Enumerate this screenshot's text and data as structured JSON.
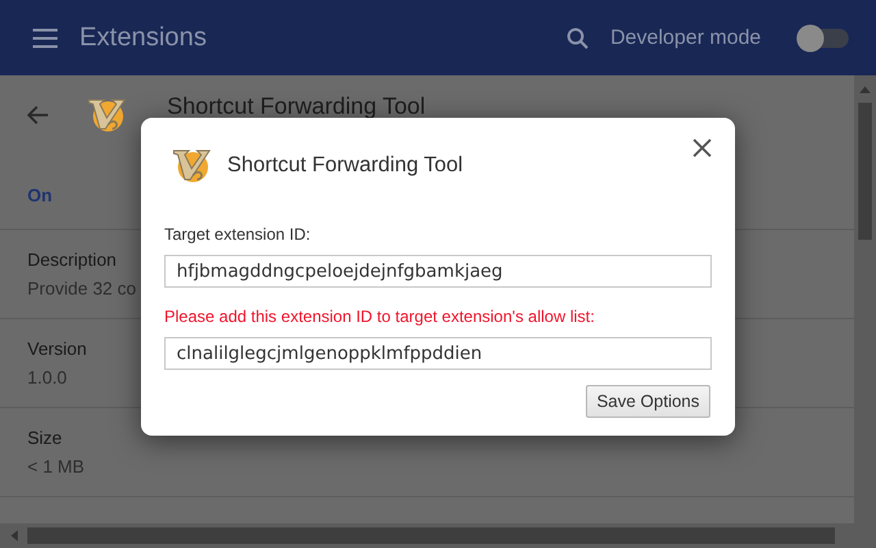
{
  "header": {
    "title": "Extensions",
    "developer_mode": {
      "label": "Developer mode",
      "on": false
    }
  },
  "detail": {
    "name": "Shortcut Forwarding Tool",
    "status": "On",
    "sections": [
      {
        "label": "Description",
        "value": "Provide 32 co"
      },
      {
        "label": "Version",
        "value": "1.0.0"
      },
      {
        "label": "Size",
        "value": "< 1 MB"
      }
    ]
  },
  "dialog": {
    "title": "Shortcut Forwarding Tool",
    "target_label": "Target extension ID:",
    "target_value": "hfjbmagddngcpeloejdejnfgbamkjaeg",
    "notice": "Please add this extension ID to target extension's allow list:",
    "own_id": "clnalilglegcjmlgenoppklmfppddien",
    "button": "Save Options"
  }
}
